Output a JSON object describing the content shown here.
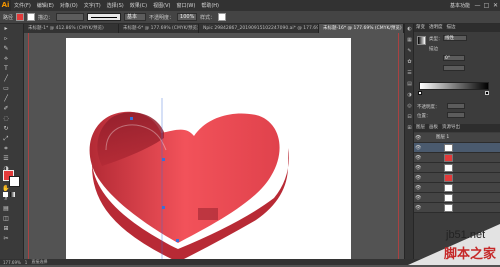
{
  "app": {
    "logo": "Ai"
  },
  "menubar": {
    "items": [
      "文件(F)",
      "编辑(E)",
      "对象(O)",
      "文字(T)",
      "选择(S)",
      "效果(C)",
      "视图(V)",
      "窗口(W)",
      "帮助(H)"
    ],
    "workspace": "基本功能",
    "win_minimize": "—",
    "win_maximize": "□",
    "win_close": "✕"
  },
  "controlbar": {
    "group_label": "路径",
    "stroke_label": "描边：",
    "style_label": "基本",
    "opacity_label": "不透明度：",
    "opacity_value": "100%",
    "style_word": "样式：",
    "fill_color": "#e23a3a",
    "stroke_color": "#ffffff"
  },
  "doc_tabs": [
    "未标题-1* @ 412.86% (CMYK/预览)",
    "未标题-6* @ 177.69% (CMYK/预览)",
    "Npic 29842867_20190915102247090.ai* @ 177.69% (RGB/预览)",
    "未标题-16* @ 177.69% (CMYK/预览)"
  ],
  "tools": [
    "▸",
    "▹",
    "✎",
    "⟡",
    "T",
    "╱",
    "▭",
    "╱",
    "✐",
    "◌",
    "↻",
    "⤢",
    "⌗",
    "☰",
    "◑",
    "✎",
    "✋",
    "⌕",
    "▤",
    "◫",
    "⊞",
    "✂"
  ],
  "right_panel": {
    "tabs_top": [
      "渐变",
      "透明度",
      "描边"
    ],
    "gradient_type_label": "类型：",
    "gradient_type_value": "线性",
    "stroke_row_label": "描边",
    "angle_value": "0°",
    "ratio_value": "",
    "opacity_label": "不透明度：",
    "position_label": "位置：",
    "layer_tabs": [
      "图层",
      "画板",
      "资源导出"
    ],
    "layers": [
      {
        "name": "图层 1",
        "selected": false
      },
      {
        "name": "",
        "selected": true
      },
      {
        "name": "",
        "selected": false
      },
      {
        "name": "",
        "selected": false
      },
      {
        "name": "",
        "selected": false
      },
      {
        "name": "",
        "selected": false
      },
      {
        "name": "",
        "selected": false
      },
      {
        "name": "",
        "selected": false
      }
    ]
  },
  "statusbar": {
    "zoom": "177.69%",
    "page": "1",
    "tool_name": "直接选择"
  },
  "watermark": {
    "domain": "jb51.net",
    "site_name": "脚本之家"
  },
  "colors": {
    "heart_light": "#f2525a",
    "heart_mid": "#e0424c",
    "heart_dark": "#b32a35",
    "heart_shadow": "#8e1d2a"
  }
}
